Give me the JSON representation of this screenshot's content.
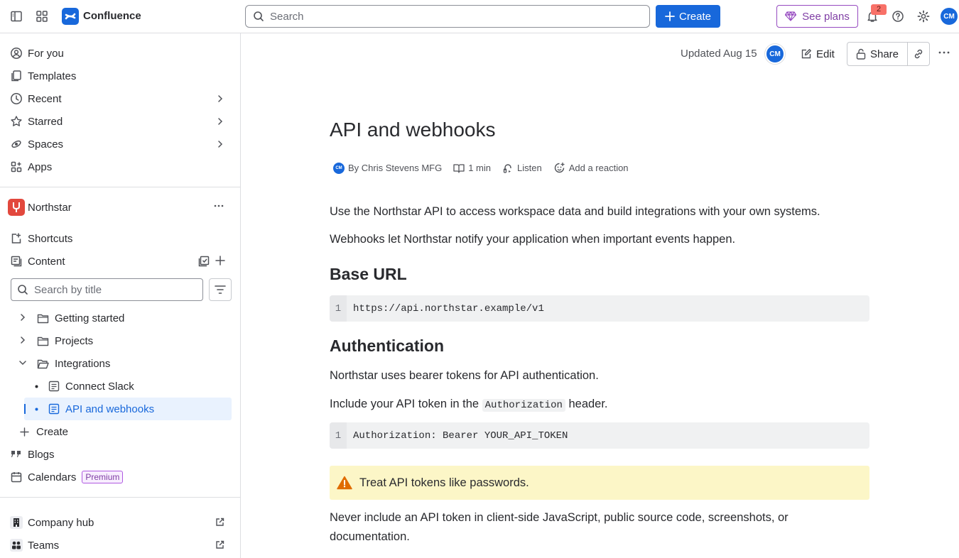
{
  "topbar": {
    "app_name": "Confluence",
    "search_placeholder": "Search",
    "create_label": "Create",
    "see_plans_label": "See plans",
    "notification_count": "2",
    "avatar_initials": "CM"
  },
  "sidebar": {
    "nav": [
      {
        "label": "For you",
        "icon": "user-circle-icon"
      },
      {
        "label": "Templates",
        "icon": "templates-icon"
      },
      {
        "label": "Recent",
        "icon": "clock-icon"
      },
      {
        "label": "Starred",
        "icon": "star-icon"
      },
      {
        "label": "Spaces",
        "icon": "spaces-icon"
      },
      {
        "label": "Apps",
        "icon": "apps-icon"
      }
    ],
    "space_name": "Northstar",
    "shortcuts_label": "Shortcuts",
    "content_label": "Content",
    "search_placeholder": "Search by title",
    "tree": [
      {
        "label": "Getting started"
      },
      {
        "label": "Projects"
      },
      {
        "label": "Integrations"
      },
      {
        "label": "Connect Slack"
      },
      {
        "label": "API and webhooks"
      }
    ],
    "create_label": "Create",
    "blogs_label": "Blogs",
    "calendars_label": "Calendars",
    "premium_label": "Premium",
    "company_hub_label": "Company hub",
    "teams_label": "Teams"
  },
  "page": {
    "updated": "Updated Aug 15",
    "avatar_initials": "CM",
    "edit_label": "Edit",
    "share_label": "Share",
    "title": "API and webhooks",
    "byline": {
      "author": "By Chris Stevens MFG",
      "read_time": "1 min",
      "listen": "Listen",
      "reaction": "Add a reaction",
      "avatar_initials": "CM"
    },
    "intro_1": "Use the Northstar API to access workspace data and build integrations with your own systems.",
    "intro_2": "Webhooks let Northstar notify your application when important events happen.",
    "h_base_url": "Base URL",
    "code_1_line": "1",
    "code_1": "https://api.northstar.example/v1",
    "h_auth": "Authentication",
    "auth_1": "Northstar uses bearer tokens for API authentication.",
    "auth_2_pre": "Include your API token in the",
    "auth_2_code": "Authorization",
    "auth_2_post": "header.",
    "code_2_line": "1",
    "code_2": "Authorization: Bearer YOUR_API_TOKEN",
    "warning": "Treat API tokens like passwords.",
    "final": "Never include an API token in client-side JavaScript, public source code, screenshots, or documentation."
  },
  "colors": {
    "brand_blue": "#1868db",
    "selected_bg": "#e9f2fe",
    "warning_bg": "#fcf6c7",
    "warning_icon": "#e06c00",
    "plans_purple": "#803fa5"
  }
}
